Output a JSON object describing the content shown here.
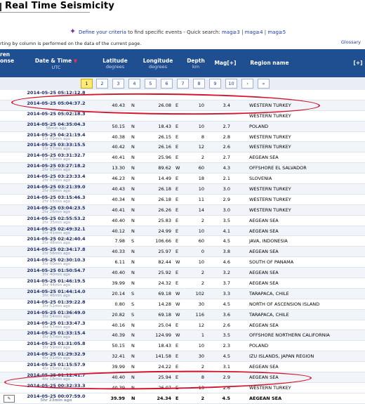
{
  "page_title": "Real Time Seismicity",
  "define": {
    "lead": "Define your criteria",
    "mid": " to find specific events - Quick search: ",
    "quick": [
      "mag≥3",
      "mag≥4",
      "mag≥5"
    ],
    "sep": " | "
  },
  "info_text": "rting by column is performed on the data of the current page.",
  "glossary": "Glossary",
  "header": {
    "col0": "ren",
    "col0b": "onse",
    "datetime": "Date & Time",
    "datetime_sub": "UTC",
    "latitude": "Latitude",
    "latitude_sub": "degrees",
    "longitude": "Longitude",
    "longitude_sub": "degrees",
    "depth": "Depth",
    "depth_sub": "km",
    "mag": "Mag[+]",
    "region": "Region name",
    "expand": "[+]"
  },
  "pager": {
    "pages": [
      "1",
      "2",
      "3",
      "4",
      "5",
      "6",
      "7",
      "8",
      "9",
      "10",
      "›",
      "»"
    ],
    "active": "1"
  },
  "rows": [
    {
      "dt": "2014-05-25 05:12:12.8",
      "ago": "",
      "lat": "",
      "ns": "",
      "lon": "",
      "ew": "",
      "dep": "",
      "mag": "",
      "reg": ""
    },
    {
      "dt": "2014-05-25 05:04:37.2",
      "ago": "",
      "lat": "40.43",
      "ns": "N",
      "lon": "26.08",
      "ew": "E",
      "dep": "10",
      "mag": "3.4",
      "reg": "WESTERN TURKEY"
    },
    {
      "dt": "2014-05-25 05:02:18.3",
      "ago": "",
      "lat": "",
      "ns": "",
      "lon": "",
      "ew": "",
      "dep": "",
      "mag": "",
      "reg": "WESTERN TURKEY"
    },
    {
      "dt": "2014-05-25 04:35:04.3",
      "ago": "56min ago",
      "lat": "50.15",
      "ns": "N",
      "lon": "18.43",
      "ew": "E",
      "dep": "10",
      "mag": "2.7",
      "reg": "POLAND"
    },
    {
      "dt": "2014-05-25 04:21:19.4",
      "ago": "1hr 09min ago",
      "lat": "40.38",
      "ns": "N",
      "lon": "26.15",
      "ew": "E",
      "dep": "8",
      "mag": "2.8",
      "reg": "WESTERN TURKEY"
    },
    {
      "dt": "2014-05-25 03:33:15.5",
      "ago": "1hr 57min ago",
      "lat": "40.42",
      "ns": "N",
      "lon": "26.16",
      "ew": "E",
      "dep": "12",
      "mag": "2.6",
      "reg": "WESTERN TURKEY"
    },
    {
      "dt": "2014-05-25 03:31:32.7",
      "ago": "1hr 59min ago",
      "lat": "40.41",
      "ns": "N",
      "lon": "25.96",
      "ew": "E",
      "dep": "2",
      "mag": "2.7",
      "reg": "AEGEAN SEA"
    },
    {
      "dt": "2014-05-25 03:27:18.2",
      "ago": "2hr 03min ago",
      "lat": "13.30",
      "ns": "N",
      "lon": "89.62",
      "ew": "W",
      "dep": "60",
      "mag": "4.3",
      "reg": "OFFSHORE EL SALVADOR"
    },
    {
      "dt": "2014-05-25 03:23:33.4",
      "ago": "2hr 07min ago",
      "lat": "46.23",
      "ns": "N",
      "lon": "14.49",
      "ew": "E",
      "dep": "18",
      "mag": "2.1",
      "reg": "SLOVENIA"
    },
    {
      "dt": "2014-05-25 03:21:39.0",
      "ago": "2hr 09min ago",
      "lat": "40.43",
      "ns": "N",
      "lon": "26.18",
      "ew": "E",
      "dep": "10",
      "mag": "3.0",
      "reg": "WESTERN TURKEY"
    },
    {
      "dt": "2014-05-25 03:15:46.3",
      "ago": "2hr 15min ago",
      "lat": "40.34",
      "ns": "N",
      "lon": "26.18",
      "ew": "E",
      "dep": "11",
      "mag": "2.9",
      "reg": "WESTERN TURKEY"
    },
    {
      "dt": "2014-05-25 03:04:23.5",
      "ago": "2hr 26min ago",
      "lat": "40.41",
      "ns": "N",
      "lon": "26.26",
      "ew": "E",
      "dep": "14",
      "mag": "3.0",
      "reg": "WESTERN TURKEY"
    },
    {
      "dt": "2014-05-25 02:55:53.2",
      "ago": "2hr 35min ago",
      "lat": "40.40",
      "ns": "N",
      "lon": "25.83",
      "ew": "E",
      "dep": "2",
      "mag": "3.5",
      "reg": "AEGEAN SEA"
    },
    {
      "dt": "2014-05-25 02:49:32.1",
      "ago": "2hr 41min ago",
      "lat": "40.12",
      "ns": "N",
      "lon": "24.99",
      "ew": "E",
      "dep": "10",
      "mag": "4.1",
      "reg": "AEGEAN SEA"
    },
    {
      "dt": "2014-05-25 02:42:40.4",
      "ago": "2hr 48min ago",
      "lat": "7.98",
      "ns": "S",
      "lon": "106.66",
      "ew": "E",
      "dep": "60",
      "mag": "4.5",
      "reg": "JAVA, INDONESIA"
    },
    {
      "dt": "2014-05-25 02:34:17.8",
      "ago": "2hr 56min ago",
      "lat": "40.33",
      "ns": "N",
      "lon": "25.97",
      "ew": "E",
      "dep": "0",
      "mag": "3.8",
      "reg": "AEGEAN SEA"
    },
    {
      "dt": "2014-05-25 02:30:10.3",
      "ago": "3hr 00min ago",
      "lat": "6.11",
      "ns": "N",
      "lon": "82.44",
      "ew": "W",
      "dep": "10",
      "mag": "4.6",
      "reg": "SOUTH OF PANAMA"
    },
    {
      "dt": "2014-05-25 01:50:54.7",
      "ago": "3hr 40min ago",
      "lat": "40.40",
      "ns": "N",
      "lon": "25.92",
      "ew": "E",
      "dep": "2",
      "mag": "3.2",
      "reg": "AEGEAN SEA"
    },
    {
      "dt": "2014-05-25 01:46:19.5",
      "ago": "3hr 44min ago",
      "lat": "39.99",
      "ns": "N",
      "lon": "24.32",
      "ew": "E",
      "dep": "2",
      "mag": "3.7",
      "reg": "AEGEAN SEA"
    },
    {
      "dt": "2014-05-25 01:44:14.0",
      "ago": "3hr 46min ago",
      "lat": "20.14",
      "ns": "S",
      "lon": "69.18",
      "ew": "W",
      "dep": "102",
      "mag": "3.3",
      "reg": "TARAPACA, CHILE"
    },
    {
      "dt": "2014-05-25 01:39:22.8",
      "ago": "3hr 51min ago",
      "lat": "0.80",
      "ns": "S",
      "lon": "14.28",
      "ew": "W",
      "dep": "30",
      "mag": "4.5",
      "reg": "NORTH OF ASCENSION ISLAND"
    },
    {
      "dt": "2014-05-25 01:36:49.0",
      "ago": "3hr 54min ago",
      "lat": "20.82",
      "ns": "S",
      "lon": "69.18",
      "ew": "W",
      "dep": "116",
      "mag": "3.6",
      "reg": "TARAPACA, CHILE"
    },
    {
      "dt": "2014-05-25 01:33:47.3",
      "ago": "3hr 57min ago",
      "lat": "40.16",
      "ns": "N",
      "lon": "25.04",
      "ew": "E",
      "dep": "12",
      "mag": "2.6",
      "reg": "AEGEAN SEA"
    },
    {
      "dt": "2014-05-25 01:33:15.4",
      "ago": "3hr 57min ago",
      "lat": "40.39",
      "ns": "N",
      "lon": "124.99",
      "ew": "W",
      "dep": "1",
      "mag": "3.5",
      "reg": "OFFSHORE NORTHERN CALIFORNIA"
    },
    {
      "dt": "2014-05-25 01:31:05.8",
      "ago": "3hr 59min ago",
      "lat": "50.15",
      "ns": "N",
      "lon": "18.43",
      "ew": "E",
      "dep": "10",
      "mag": "2.3",
      "reg": "POLAND"
    },
    {
      "dt": "2014-05-25 01:29:32.9",
      "ago": "4hr 01min ago",
      "lat": "32.41",
      "ns": "N",
      "lon": "141.58",
      "ew": "E",
      "dep": "30",
      "mag": "4.5",
      "reg": "IZU ISLANDS, JAPAN REGION"
    },
    {
      "dt": "2014-05-25 01:15:57.9",
      "ago": "4hr 15min ago",
      "lat": "39.99",
      "ns": "N",
      "lon": "24.22",
      "ew": "E",
      "dep": "2",
      "mag": "3.1",
      "reg": "AEGEAN SEA"
    },
    {
      "dt": "2014-05-25 01:12:41.7",
      "ago": "4hr 18min ago",
      "lat": "40.40",
      "ns": "N",
      "lon": "25.94",
      "ew": "E",
      "dep": "8",
      "mag": "2.9",
      "reg": "AEGEAN SEA"
    },
    {
      "dt": "2014-05-25 00:32:33.3",
      "ago": "",
      "lat": "40.39",
      "ns": "N",
      "lon": "26.07",
      "ew": "E",
      "dep": "13",
      "mag": "2.6",
      "reg": "WESTERN TURKEY"
    },
    {
      "dt": "2014-05-25 00:07:59.0",
      "ago": "5hr 23min ago",
      "lat": "39.99",
      "ns": "N",
      "lon": "24.34",
      "ew": "E",
      "dep": "2",
      "mag": "4.5",
      "reg": "AEGEAN SEA"
    }
  ]
}
